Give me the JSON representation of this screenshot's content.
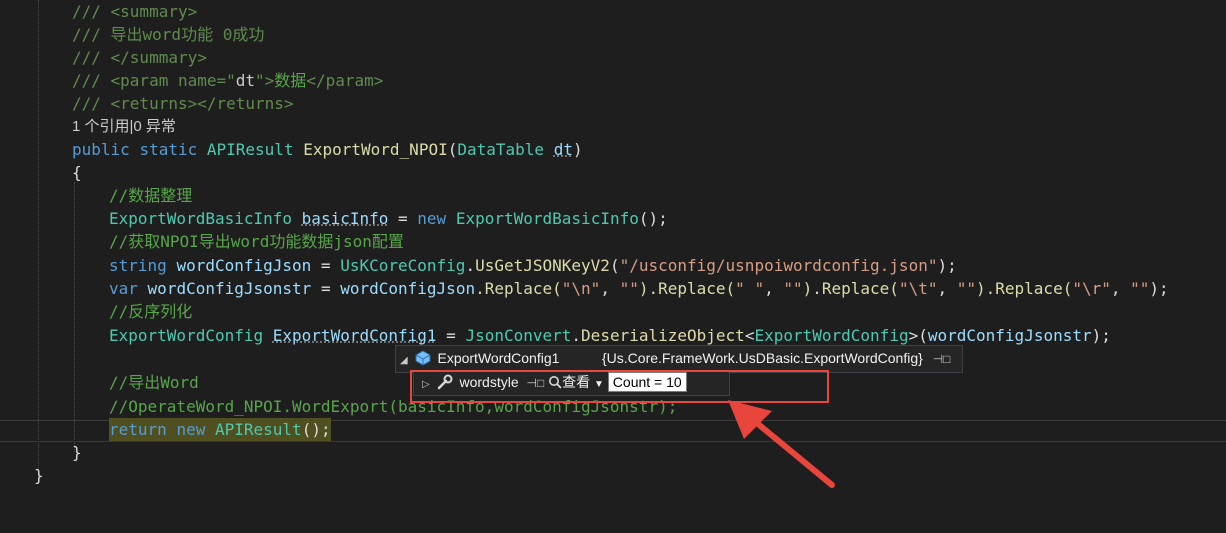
{
  "code": {
    "summary_open": "/// <summary>",
    "comment_export": "/// 导出word功能 0成功",
    "summary_close": "/// </summary>",
    "param_prefix": "/// <param name=\"",
    "param_name": "dt",
    "param_mid": "\">",
    "param_text": "数据",
    "param_close": "</param>",
    "returns": "/// <returns></returns>",
    "codelens": "1 个引用|0 异常",
    "sig": {
      "public": "public",
      "static": "static",
      "type": "APIResult",
      "method": "ExportWord_NPOI",
      "open": "(",
      "ptype": "DataTable",
      "pname": "dt",
      "close": ")"
    },
    "brace_open": "{",
    "c_data": "//数据整理",
    "l1": {
      "type": "ExportWordBasicInfo",
      "var": "basicInfo",
      "eq": " = ",
      "new": "new",
      "ctor": "ExportWordBasicInfo",
      "end": "();"
    },
    "c_cfg": "//获取NPOI导出word功能数据json配置",
    "l2": {
      "kw": "string",
      "var": "wordConfigJson",
      "eq": " = ",
      "cls": "UsKCoreConfig",
      "dot": ".",
      "method": "UsGetJSONKeyV2",
      "open": "(",
      "str": "\"/usconfig/usnpoiwordconfig.json\"",
      "end": ");"
    },
    "l3": {
      "kw": "var",
      "var": "wordConfigJsonstr",
      "eq": " = ",
      "obj": "wordConfigJson",
      "r1": ".Replace(",
      "s1": "\"\\n\"",
      "sep1": ", ",
      "e1": "\"\"",
      "r2": ").Replace(",
      "s2": "\" \"",
      "sep2": ", ",
      "e2": "\"\"",
      "r3": ").Replace(",
      "s3": "\"\\t\"",
      "sep3": ", ",
      "e3": "\"\"",
      "r4": ").Replace(",
      "s4": "\"\\r\"",
      "sep4": ", ",
      "e4": "\"\"",
      "end": ");"
    },
    "c_deser": "//反序列化",
    "l4": {
      "type": "ExportWordConfig",
      "var": "ExportWordConfig1",
      "eq": " = ",
      "cls": "JsonConvert",
      "dot": ".",
      "method": "DeserializeObject",
      "lt": "<",
      "gtype": "ExportWordConfig",
      "gt": ">",
      "open": "(",
      "arg": "wordConfigJsonstr",
      "end": ");"
    },
    "c_word": "//导出Word",
    "c_operate": "//OperateWord_NPOI.WordExport(basicInfo,wordConfigJsonstr);",
    "ret": {
      "kw": "return",
      "new": "new",
      "type": "APIResult",
      "end": "();"
    },
    "brace_close": "}",
    "class_close": "}"
  },
  "datatip": {
    "root_name": "ExportWordConfig1",
    "root_value": "{Us.Core.FrameWork.UsDBasic.ExportWordConfig}",
    "child_name": "wordstyle",
    "child_view_label": "查看",
    "child_value": "Count = 10"
  },
  "colors": {
    "annotation": "#e8453c",
    "background": "#1e1e1e"
  },
  "icons": [
    "expand-collapse-icon",
    "object-icon",
    "wrench-icon",
    "pin-icon",
    "magnifier-icon",
    "dropdown-arrow-icon",
    "annotation-arrow-icon"
  ]
}
